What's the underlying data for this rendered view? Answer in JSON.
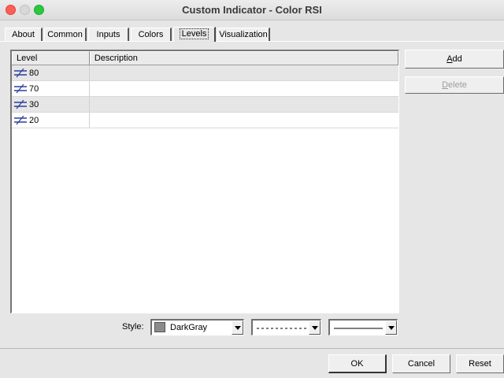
{
  "window": {
    "title": "Custom Indicator - Color RSI"
  },
  "tabs": [
    {
      "label": "About"
    },
    {
      "label": "Common"
    },
    {
      "label": "Inputs"
    },
    {
      "label": "Colors"
    },
    {
      "label": "Levels",
      "active": true
    },
    {
      "label": "Visualization"
    }
  ],
  "levels_table": {
    "columns": [
      "Level",
      "Description"
    ],
    "rows": [
      {
        "level": "80",
        "description": ""
      },
      {
        "level": "70",
        "description": ""
      },
      {
        "level": "30",
        "description": ""
      },
      {
        "level": "20",
        "description": ""
      }
    ],
    "row_icon": "level-line-icon"
  },
  "buttons": {
    "add": {
      "prefix": "",
      "accel": "A",
      "rest": "dd"
    },
    "delete": {
      "prefix": "",
      "accel": "D",
      "rest": "elete",
      "disabled": true
    },
    "ok": "OK",
    "cancel": "Cancel",
    "reset": "Reset"
  },
  "style": {
    "label": "Style:",
    "color_name": "DarkGray",
    "color_hex": "#8c8c8c",
    "dash_style": "dashed",
    "line_width": "thin"
  }
}
